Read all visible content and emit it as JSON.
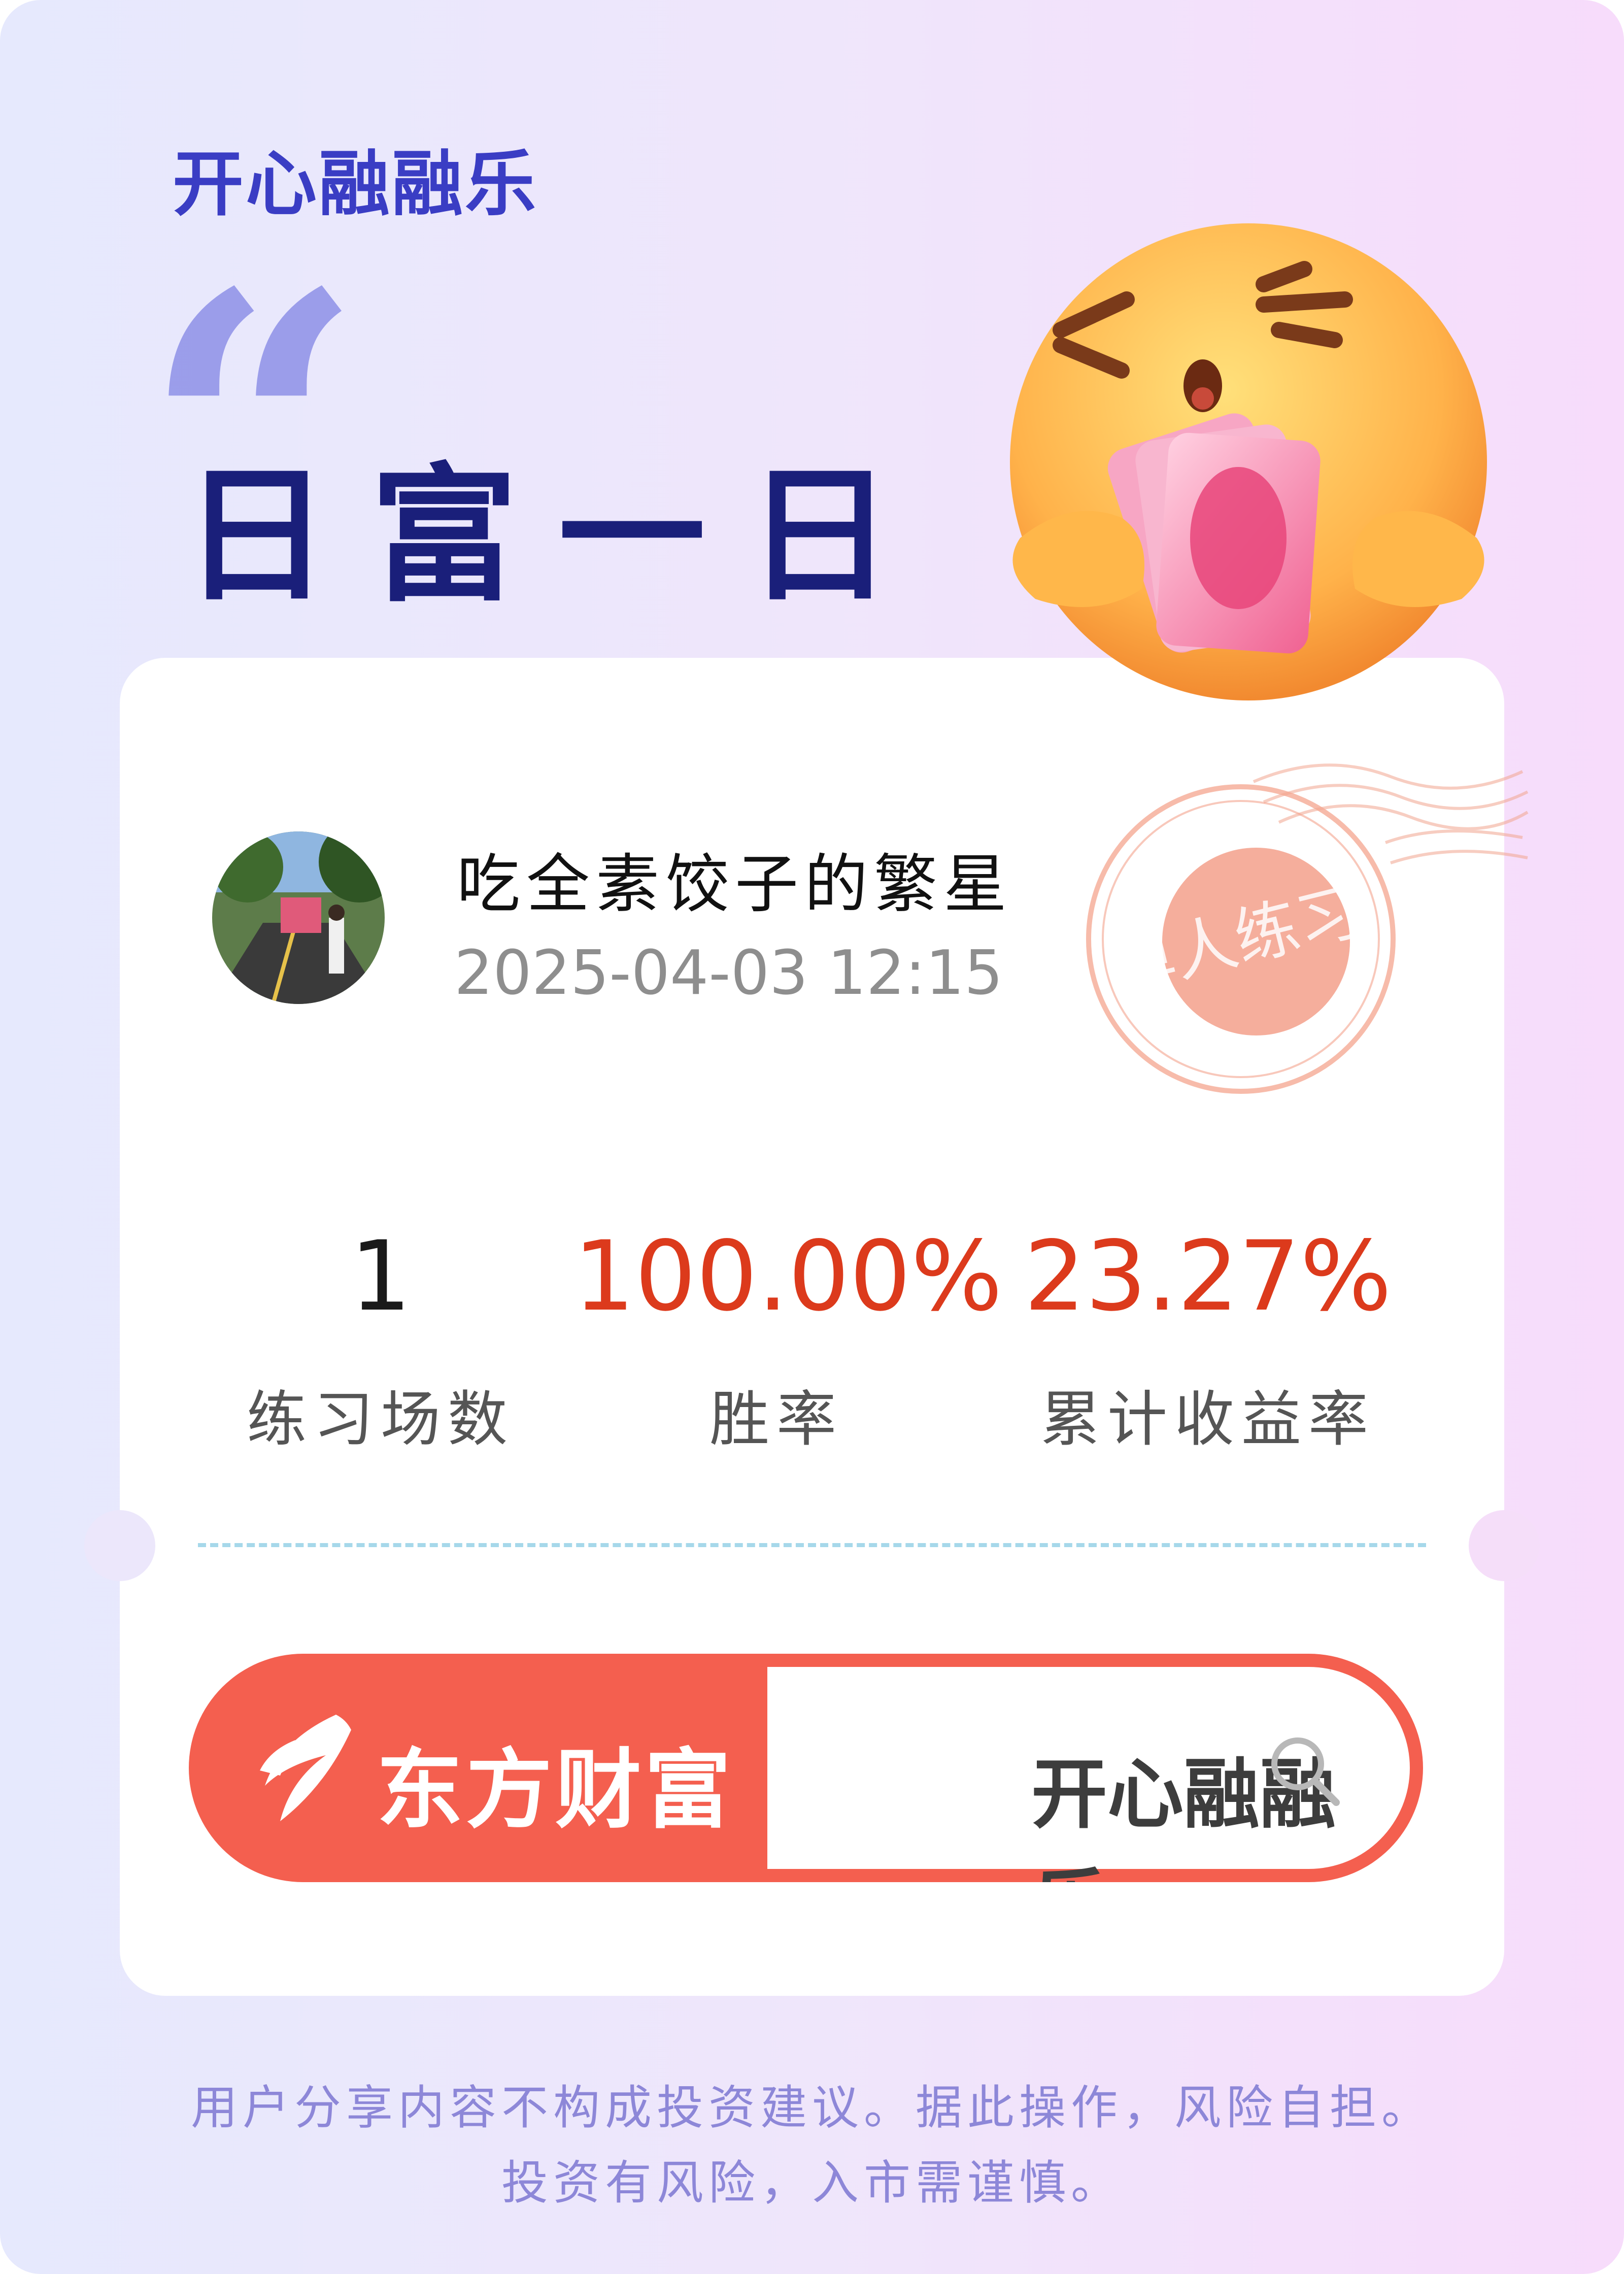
{
  "header": {
    "brand_top": "开心融融乐",
    "quote_mark": "“",
    "headline": "日富一日"
  },
  "decorations": {
    "emoji": "money-hug-face-emoji",
    "stamp_text": "单人练习"
  },
  "profile": {
    "username": "吃全素饺子的繁星",
    "datetime": "2025-04-03  12:15"
  },
  "stats": [
    {
      "value": "1",
      "label": "练习场数",
      "color": "#1a1a1a"
    },
    {
      "value": "100.00%",
      "label": "胜率",
      "color": "#dc3a1c"
    },
    {
      "value": "23.27%",
      "label": "累计收益率",
      "color": "#dc3a1c"
    }
  ],
  "search_bar": {
    "brand": "东方财富",
    "query": "开心融融乐",
    "icon": "search-icon"
  },
  "disclaimer": {
    "line1": "用户分享内容不构成投资建议。据此操作，风险自担。",
    "line2": "投资有风险，入市需谨慎。"
  },
  "colors": {
    "accent_red": "#f45f4f",
    "stat_red": "#dc3a1c",
    "headline_navy": "#1a1f7a",
    "brand_blue": "#3a3dc4"
  }
}
